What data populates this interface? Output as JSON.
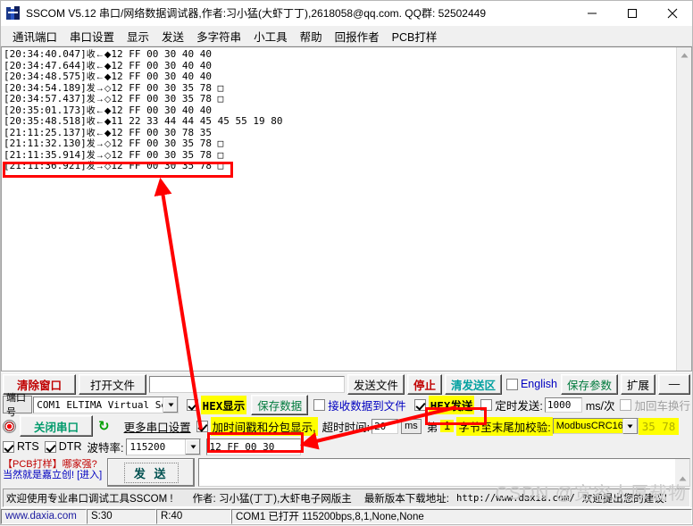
{
  "window": {
    "title": "SSCOM V5.12 串口/网络数据调试器,作者:习小猛(大虾丁丁),2618058@qq.com. QQ群: 52502449",
    "minimize": "—",
    "maximize": "□",
    "close": "✕"
  },
  "menu": {
    "items": [
      {
        "label": "通讯端口"
      },
      {
        "label": "串口设置"
      },
      {
        "label": "显示"
      },
      {
        "label": "发送"
      },
      {
        "label": "多字符串"
      },
      {
        "label": "小工具"
      },
      {
        "label": "帮助"
      },
      {
        "label": "回报作者"
      },
      {
        "label": "PCB打样"
      }
    ]
  },
  "log": {
    "lines": [
      {
        "time": "[20:34:40.047]",
        "dir": "收←◆",
        "data": "12 FF 00 30 40 40"
      },
      {
        "time": "[20:34:47.644]",
        "dir": "收←◆",
        "data": "12 FF 00 30 40 40"
      },
      {
        "time": "[20:34:48.575]",
        "dir": "收←◆",
        "data": "12 FF 00 30 40 40"
      },
      {
        "time": "[20:34:54.189]",
        "dir": "发→◇",
        "data": "12 FF 00 30 35 78 □"
      },
      {
        "time": "[20:34:57.437]",
        "dir": "发→◇",
        "data": "12 FF 00 30 35 78 □"
      },
      {
        "time": "[20:35:01.173]",
        "dir": "收←◆",
        "data": "12 FF 00 30 40 40"
      },
      {
        "time": "[20:35:48.518]",
        "dir": "收←◆",
        "data": "11 22 33 44 44 45 45 55 19 80"
      },
      {
        "time": "[21:11:25.137]",
        "dir": "收←◆",
        "data": "12 FF 00 30 78 35"
      },
      {
        "time": "[21:11:32.130]",
        "dir": "发→◇",
        "data": "12 FF 00 30 35 78 □"
      },
      {
        "time": "[21:11:35.914]",
        "dir": "发→◇",
        "data": "12 FF 00 30 35 78 □"
      },
      {
        "time": "[21:11:36.921]",
        "dir": "发→◇",
        "data": "12 FF 00 30 35 78 □"
      }
    ],
    "scroll_up_icon": "▲"
  },
  "toolbar_row1": {
    "clear_window": "清除窗口",
    "open_file": "打开文件",
    "file_path": "",
    "send_file": "发送文件",
    "stop": "停止",
    "clear_send": "清发送区",
    "english_checkbox": "English",
    "save_params": "保存参数",
    "expand": "扩展",
    "collapse_icon": "—"
  },
  "port": {
    "port_label": "端口号",
    "port_value": "COM1 ELTIMA Virtual Serial",
    "close_port": "关闭串口",
    "refresh_icon": "↻",
    "more_settings": "更多串口设置",
    "rts": "RTS",
    "dtr": "DTR",
    "baud_label": "波特率:",
    "baud_value": "115200"
  },
  "display": {
    "hex_display": "HEX显示",
    "save_data": "保存数据",
    "recv_to_file": "接收数据到文件",
    "timestamp_packet": "加时间戳和分包显示,",
    "timeout_label": "超时时间:",
    "timeout_value": "20",
    "timeout_unit": "ms"
  },
  "send": {
    "hex_send": "HEX发送",
    "timed_send": "定时发送:",
    "timed_value": "1000",
    "timed_unit": "ms/次",
    "append_crlf": "加回车换行",
    "nth_label": "第",
    "nth_value": "1",
    "checksum_label": "字节至末尾加校验:",
    "checksum_type": "ModbusCRC16",
    "checksum_value": "35 78",
    "send_text": "12 FF 00 30",
    "send_button": "发  送"
  },
  "ad": {
    "line1": "【PCB打样】哪家强?",
    "line2": "当然就是嘉立创! [进入]"
  },
  "info": {
    "welcome": "欢迎使用专业串口调试工具SSCOM !",
    "author": "作者: 习小猛(丁丁),大虾电子网版主",
    "download_label": "最新版本下载地址:",
    "url": "http://www.daxia.com/",
    "suggest": "欢迎提出您的建议!"
  },
  "status": {
    "site": "www.daxia.com",
    "sent": "S:30",
    "received": "R:40",
    "port_status": "COM1 已打开  115200bps,8,1,None,None"
  },
  "watermark": {
    "text": "CSDN @宽容人厚载物"
  },
  "colors": {
    "highlight": "#ffff00",
    "annotation": "#ff0000",
    "accent_green": "#009a6b",
    "accent_red": "#c00000"
  }
}
